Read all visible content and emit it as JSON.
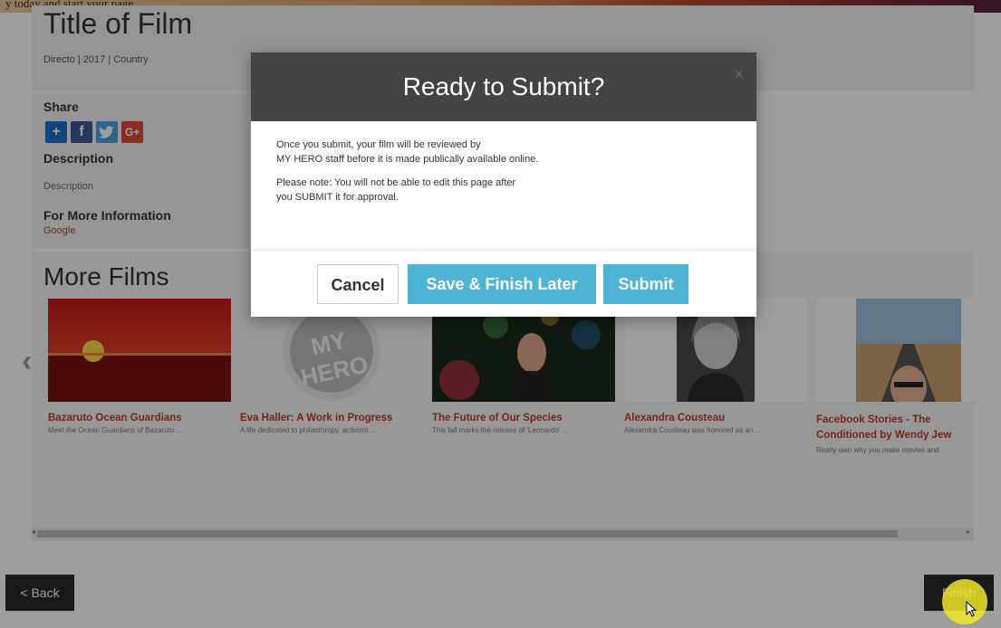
{
  "top_strip_text": "y today and start your page",
  "film": {
    "title": "Title of Film",
    "meta": "Directo | 2017 | Country"
  },
  "info": {
    "share_label": "Share",
    "social": [
      {
        "name": "addthis-icon",
        "glyph": "+",
        "color": "#1a6fc8"
      },
      {
        "name": "facebook-icon",
        "glyph": "f",
        "color": "#3b5998"
      },
      {
        "name": "twitter-icon",
        "glyph": "t",
        "color": "#4aa3df"
      },
      {
        "name": "googleplus-icon",
        "glyph": "G+",
        "color": "#dd4b39"
      }
    ],
    "description_label": "Description",
    "description_text": "Description",
    "more_info_label": "For More Information",
    "more_info_link": "Google"
  },
  "more_films": {
    "heading": "More Films",
    "prev_glyph": "‹",
    "items": [
      {
        "title": "Bazaruto Ocean Guardians",
        "desc": "Meet the Ocean Guardians of Bazaruto ..."
      },
      {
        "title": "Eva Haller: A Work in Progress",
        "desc": "A life dedicated to philanthropy, activism ..."
      },
      {
        "title": "The Future of Our Species",
        "desc": "This fall marks the release of 'Leonardo' ..."
      },
      {
        "title": "Alexandra Cousteau",
        "desc": "Alexandra Cousteau was honored as an ..."
      },
      {
        "title": "Facebook Stories - The Conditioned by Wendy Jew",
        "desc": "Really own why you make movies and"
      }
    ],
    "thumb_text_1": "MY HERO"
  },
  "scrollbar": {
    "left_arrow": "◂",
    "right_arrow": "▸"
  },
  "nav": {
    "back": "< Back",
    "finish": "Finish"
  },
  "modal": {
    "title": "Ready to Submit?",
    "close": "×",
    "body_p1_line1": "Once you submit, your film will be reviewed by",
    "body_p1_line2": "MY HERO staff before it is made publically available online.",
    "body_p2_line1": "Please note: You will not be able to edit this page after",
    "body_p2_line2": "you SUBMIT it for approval.",
    "cancel": "Cancel",
    "save_later": "Save & Finish Later",
    "submit": "Submit"
  }
}
